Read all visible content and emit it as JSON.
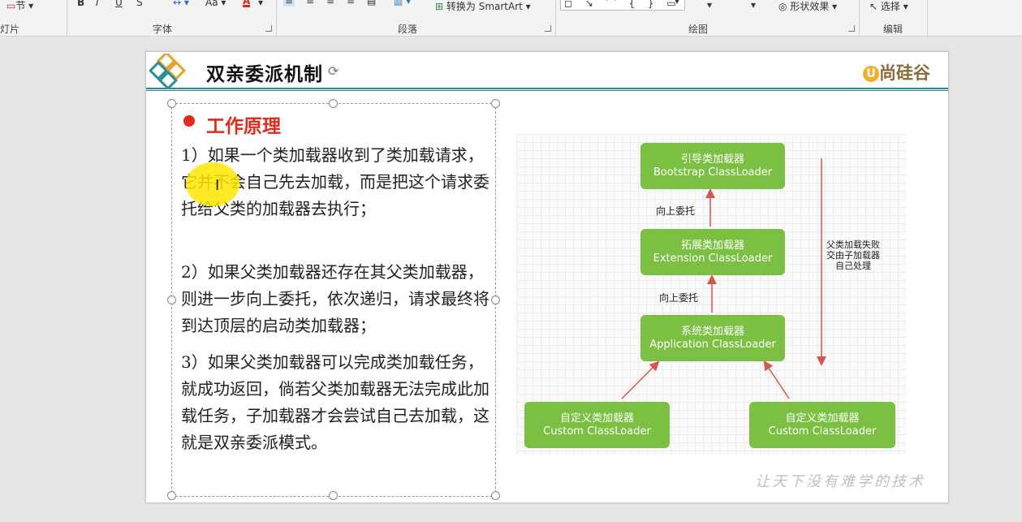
{
  "ribbon": {
    "partial_left_top": "节",
    "partial_left_label": "灯片",
    "group_font_label": "字体",
    "font_size_label": "Aa",
    "group_paragraph_label": "段落",
    "convert_smartart": "转换为 SmartArt",
    "group_drawing_label": "绘图",
    "shape_effects": "形状效果",
    "select_label": "选择",
    "group_edit_label": "编辑"
  },
  "slide": {
    "title": "双亲委派机制",
    "brand": "尚硅谷",
    "heading": "工作原理",
    "paragraphs": [
      "1）如果一个类加载器收到了类加载请求，它并不会自己先去加载，而是把这个请求委托给父类的加载器去执行；",
      "2）如果父类加载器还存在其父类加载器，则进一步向上委托，依次递归，请求最终将到达顶层的启动类加载器；",
      "3）如果父类加载器可以完成类加载任务，就成功返回，倘若父类加载器无法完成此加载任务，子加载器才会尝试自己去加载，这就是双亲委派模式。"
    ],
    "watermark": "让天下没有难学的技术"
  },
  "diagram": {
    "bootstrap": {
      "cn": "引导类加载器",
      "en": "Bootstrap ClassLoader"
    },
    "extension": {
      "cn": "拓展类加载器",
      "en": "Extension ClassLoader"
    },
    "application": {
      "cn": "系统类加载器",
      "en": "Application ClassLoader"
    },
    "custom_left": {
      "cn": "自定义类加载器",
      "en": "Custom ClassLoader"
    },
    "custom_right": {
      "cn": "自定义类加载器",
      "en": "Custom ClassLoader"
    },
    "delegate_up_1": "向上委托",
    "delegate_up_2": "向上委托",
    "fail_note": [
      "父类加载失败",
      "交由子加载器",
      "自己处理"
    ],
    "box_color": "#7bc043",
    "arrow_color": "#d9534f"
  }
}
